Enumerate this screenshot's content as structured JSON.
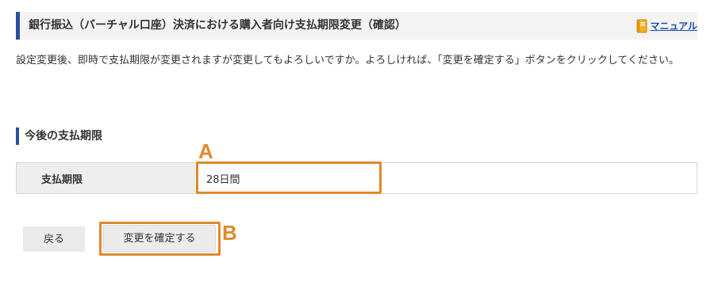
{
  "header": {
    "title": "銀行振込（バーチャル口座）決済における購入者向け支払期限変更（確認）",
    "manual_label": "マニュアル",
    "manual_icon": "manual-book-icon"
  },
  "description": "設定変更後、即時で支払期限が変更されますが変更してもよろしいですか。よろしければ、「変更を確定する」ボタンをクリックしてください。",
  "section": {
    "title": "今後の支払期限"
  },
  "table": {
    "rows": [
      {
        "label": "支払期限",
        "value": "28日間"
      }
    ]
  },
  "buttons": {
    "back_label": "戻る",
    "confirm_label": "変更を確定する"
  },
  "annotations": {
    "a_label": "A",
    "b_label": "B",
    "color": "#e08a2a"
  },
  "colors": {
    "accent": "#2a4f9c",
    "link": "#1a4fb0",
    "header_bg": "#f3f3f3",
    "table_header_bg": "#eeeeee"
  }
}
